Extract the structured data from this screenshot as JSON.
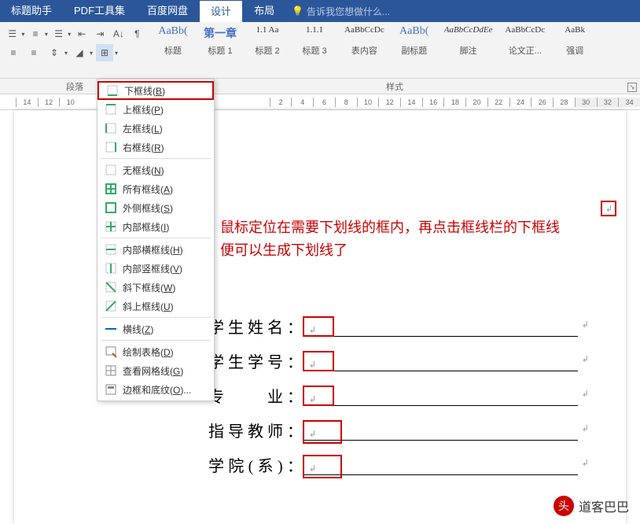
{
  "ribbon": {
    "tabs": [
      "标题助手",
      "PDF工具集",
      "百度网盘",
      "设计",
      "布局"
    ],
    "tell_me": "告诉我您想做什么...",
    "group_paragraph": "段落",
    "group_styles": "样式"
  },
  "styles": [
    {
      "sample": "AaBb(",
      "name": "标题"
    },
    {
      "sample": "第一章",
      "name": "标题 1"
    },
    {
      "sample": "1.1 Aa",
      "name": "标题 2"
    },
    {
      "sample": "1.1.1",
      "name": "标题 3"
    },
    {
      "sample": "AaBbCcDc",
      "name": "表内容"
    },
    {
      "sample": "AaBb(",
      "name": "副标题"
    },
    {
      "sample": "AaBbCcDdEe",
      "name": "脚注"
    },
    {
      "sample": "AaBbCcDc",
      "name": "论文正..."
    },
    {
      "sample": "AaBk",
      "name": "强调"
    }
  ],
  "ruler": {
    "left": [
      "14",
      "12",
      "10"
    ],
    "right": [
      "2",
      "4",
      "6",
      "8",
      "10",
      "12",
      "14",
      "16",
      "18",
      "20",
      "22",
      "24",
      "26",
      "28",
      "30",
      "32",
      "34"
    ]
  },
  "border_menu": [
    {
      "label": "下框线",
      "key": "B",
      "icon": "bottom",
      "hl": true
    },
    {
      "label": "上框线",
      "key": "P",
      "icon": "top"
    },
    {
      "label": "左框线",
      "key": "L",
      "icon": "left"
    },
    {
      "label": "右框线",
      "key": "R",
      "icon": "right"
    },
    {
      "sep": true
    },
    {
      "label": "无框线",
      "key": "N",
      "icon": "none"
    },
    {
      "label": "所有框线",
      "key": "A",
      "icon": "all"
    },
    {
      "label": "外侧框线",
      "key": "S",
      "icon": "outside"
    },
    {
      "label": "内部框线",
      "key": "I",
      "icon": "inside"
    },
    {
      "sep": true
    },
    {
      "label": "内部横框线",
      "key": "H",
      "icon": "inh"
    },
    {
      "label": "内部竖框线",
      "key": "V",
      "icon": "inv"
    },
    {
      "label": "斜下框线",
      "key": "W",
      "icon": "diagd"
    },
    {
      "label": "斜上框线",
      "key": "U",
      "icon": "diagu"
    },
    {
      "sep": true
    },
    {
      "label": "横线",
      "key": "Z",
      "icon": "hline"
    },
    {
      "sep": true
    },
    {
      "label": "绘制表格",
      "key": "D",
      "icon": "draw"
    },
    {
      "label": "查看网格线",
      "key": "G",
      "icon": "grid"
    },
    {
      "label": "边框和底纹",
      "key": "O",
      "icon": "dlg",
      "dots": true
    }
  ],
  "annotation": {
    "line1": "鼠标定位在需要下划线的框内，再点击框线栏的下框线",
    "line2": "便可以生成下划线了"
  },
  "form": [
    {
      "label": "学生姓名："
    },
    {
      "label": "学生学号："
    },
    {
      "label": "专　　业："
    },
    {
      "label": "指导教师："
    },
    {
      "label": "学院(系)："
    }
  ],
  "watermark": {
    "avatar": "头",
    "text": "道客巴巴"
  }
}
